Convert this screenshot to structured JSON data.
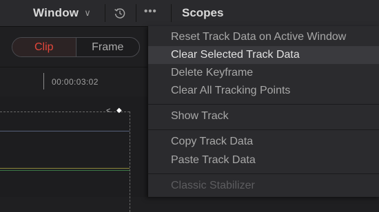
{
  "topbar": {
    "window_label": "Window",
    "chevron": "∨",
    "reset_icon": "reset-icon",
    "more_label": "•••",
    "scopes_label": "Scopes"
  },
  "left": {
    "clip_label": "Clip",
    "frame_label": "Frame",
    "timecode": "00:00:03:02"
  },
  "menu": {
    "items": [
      {
        "label": "Reset Track Data on Active Window",
        "state": "normal"
      },
      {
        "label": "Clear Selected Track Data",
        "state": "highlighted"
      },
      {
        "label": "Delete Keyframe",
        "state": "normal"
      },
      {
        "label": "Clear All Tracking Points",
        "state": "normal"
      },
      {
        "label": "Show Track",
        "state": "normal"
      },
      {
        "label": "Copy Track Data",
        "state": "normal"
      },
      {
        "label": "Paste Track Data",
        "state": "normal"
      },
      {
        "label": "Classic Stabilizer",
        "state": "disabled"
      }
    ]
  },
  "colors": {
    "accent_red": "#e4473b",
    "menu_bg": "#2b2b2e",
    "highlight_bg": "#3a3a3e"
  }
}
